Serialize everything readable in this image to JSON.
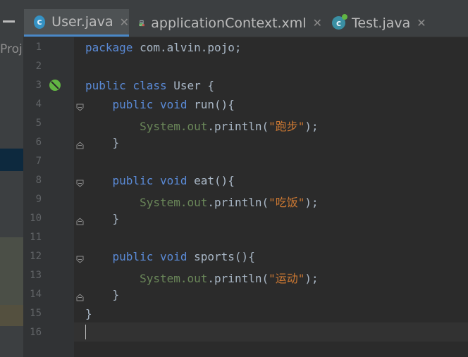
{
  "tabs": [
    {
      "label": "User.java",
      "icon": "c-class-icon",
      "active": true
    },
    {
      "label": "applicationContext.xml",
      "icon": "xml-file-icon",
      "active": false
    },
    {
      "label": "Test.java",
      "icon": "test-class-icon",
      "active": false
    }
  ],
  "project_panel": {
    "label": "Proj"
  },
  "editor": {
    "line_numbers": [
      "1",
      "2",
      "3",
      "4",
      "5",
      "6",
      "7",
      "8",
      "9",
      "10",
      "11",
      "12",
      "13",
      "14",
      "15",
      "16"
    ],
    "lines": [
      [
        {
          "t": "package ",
          "c": "kw-blue"
        },
        {
          "t": "com.alvin.pojo",
          "c": "cls"
        },
        {
          "t": ";",
          "c": "cls"
        }
      ],
      [],
      [
        {
          "t": "public class ",
          "c": "kw-blue"
        },
        {
          "t": "User ",
          "c": "cls"
        },
        {
          "t": "{",
          "c": "cls"
        }
      ],
      [
        {
          "t": "    public void ",
          "c": "kw-blue"
        },
        {
          "t": "run(){",
          "c": "cls"
        }
      ],
      [
        {
          "t": "        System.",
          "c": "str"
        },
        {
          "t": "out",
          "c": "str"
        },
        {
          "t": ".println(",
          "c": "cls"
        },
        {
          "t": "\"跑步\"",
          "c": "kw"
        },
        {
          "t": ");",
          "c": "cls"
        }
      ],
      [
        {
          "t": "    }",
          "c": "cls"
        }
      ],
      [],
      [
        {
          "t": "    public void ",
          "c": "kw-blue"
        },
        {
          "t": "eat(){",
          "c": "cls"
        }
      ],
      [
        {
          "t": "        System.",
          "c": "str"
        },
        {
          "t": "out",
          "c": "str"
        },
        {
          "t": ".println(",
          "c": "cls"
        },
        {
          "t": "\"吃饭\"",
          "c": "kw"
        },
        {
          "t": ");",
          "c": "cls"
        }
      ],
      [
        {
          "t": "    }",
          "c": "cls"
        }
      ],
      [],
      [
        {
          "t": "    public void ",
          "c": "kw-blue"
        },
        {
          "t": "sports(){",
          "c": "cls"
        }
      ],
      [
        {
          "t": "        System.",
          "c": "str"
        },
        {
          "t": "out",
          "c": "str"
        },
        {
          "t": ".println(",
          "c": "cls"
        },
        {
          "t": "\"运动\"",
          "c": "kw"
        },
        {
          "t": ");",
          "c": "cls"
        }
      ],
      [
        {
          "t": "    }",
          "c": "cls"
        }
      ],
      [
        {
          "t": "}",
          "c": "cls"
        }
      ],
      []
    ],
    "fold_markers": {
      "open": [
        4,
        8,
        12
      ],
      "close": [
        6,
        10,
        14
      ]
    },
    "bean_gutter_icon_line": 3,
    "current_line": 16
  },
  "colors": {
    "background": "#2b2b2b",
    "gutter": "#313335",
    "keyword": "#5a8ad6",
    "string": "#cc7832",
    "field": "#6a8759",
    "plain": "#a9b7c6",
    "line_number": "#606366",
    "tab_accent": "#4a88c7"
  }
}
